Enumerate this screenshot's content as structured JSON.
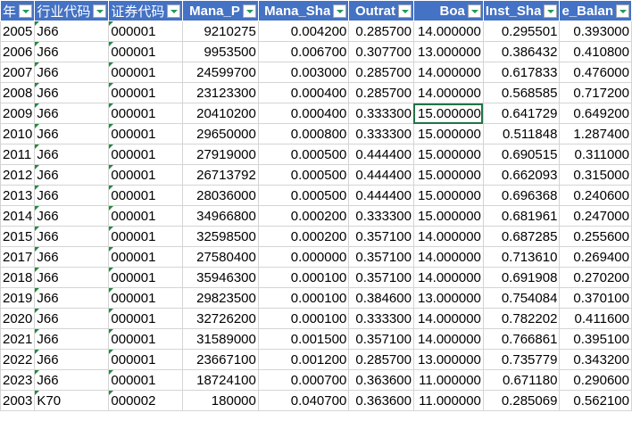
{
  "columns": [
    {
      "key": "year",
      "label": "年",
      "align": "txt"
    },
    {
      "key": "industry",
      "label": "行业代码",
      "align": "txt"
    },
    {
      "key": "code",
      "label": "证券代码",
      "align": "txt"
    },
    {
      "key": "mana_p",
      "label": "Mana_P",
      "align": "num"
    },
    {
      "key": "mana_sha",
      "label": "Mana_Sha",
      "align": "num"
    },
    {
      "key": "outrat",
      "label": "Outrat",
      "align": "num"
    },
    {
      "key": "boa",
      "label": "Boa",
      "align": "num"
    },
    {
      "key": "inst_sha",
      "label": "Inst_Sha",
      "align": "num"
    },
    {
      "key": "balance",
      "label": "e_Balan",
      "align": "num"
    }
  ],
  "rows": [
    [
      "2005",
      "J66",
      "000001",
      "9210275",
      "0.004200",
      "0.285700",
      "14.000000",
      "0.295501",
      "0.393000"
    ],
    [
      "2006",
      "J66",
      "000001",
      "9953500",
      "0.006700",
      "0.307700",
      "13.000000",
      "0.386432",
      "0.410800"
    ],
    [
      "2007",
      "J66",
      "000001",
      "24599700",
      "0.003000",
      "0.285700",
      "14.000000",
      "0.617833",
      "0.476000"
    ],
    [
      "2008",
      "J66",
      "000001",
      "23123300",
      "0.000400",
      "0.285700",
      "14.000000",
      "0.568585",
      "0.717200"
    ],
    [
      "2009",
      "J66",
      "000001",
      "20410200",
      "0.000400",
      "0.333300",
      "15.000000",
      "0.641729",
      "0.649200"
    ],
    [
      "2010",
      "J66",
      "000001",
      "29650000",
      "0.000800",
      "0.333300",
      "15.000000",
      "0.511848",
      "1.287400"
    ],
    [
      "2011",
      "J66",
      "000001",
      "27919000",
      "0.000500",
      "0.444400",
      "15.000000",
      "0.690515",
      "0.311000"
    ],
    [
      "2012",
      "J66",
      "000001",
      "26713792",
      "0.000500",
      "0.444400",
      "15.000000",
      "0.662093",
      "0.315000"
    ],
    [
      "2013",
      "J66",
      "000001",
      "28036000",
      "0.000500",
      "0.444400",
      "15.000000",
      "0.696368",
      "0.240600"
    ],
    [
      "2014",
      "J66",
      "000001",
      "34966800",
      "0.000200",
      "0.333300",
      "15.000000",
      "0.681961",
      "0.247000"
    ],
    [
      "2015",
      "J66",
      "000001",
      "32598500",
      "0.000200",
      "0.357100",
      "14.000000",
      "0.687285",
      "0.255600"
    ],
    [
      "2017",
      "J66",
      "000001",
      "27580400",
      "0.000000",
      "0.357100",
      "14.000000",
      "0.713610",
      "0.269400"
    ],
    [
      "2018",
      "J66",
      "000001",
      "35946300",
      "0.000100",
      "0.357100",
      "14.000000",
      "0.691908",
      "0.270200"
    ],
    [
      "2019",
      "J66",
      "000001",
      "29823500",
      "0.000100",
      "0.384600",
      "13.000000",
      "0.754084",
      "0.370100"
    ],
    [
      "2020",
      "J66",
      "000001",
      "32726200",
      "0.000100",
      "0.333300",
      "14.000000",
      "0.782202",
      "0.411600"
    ],
    [
      "2021",
      "J66",
      "000001",
      "31589000",
      "0.001500",
      "0.357100",
      "14.000000",
      "0.766861",
      "0.395100"
    ],
    [
      "2022",
      "J66",
      "000001",
      "23667100",
      "0.001200",
      "0.285700",
      "13.000000",
      "0.735779",
      "0.343200"
    ],
    [
      "2023",
      "J66",
      "000001",
      "18724100",
      "0.000700",
      "0.363600",
      "11.000000",
      "0.671180",
      "0.290600"
    ],
    [
      "2003",
      "K70",
      "000002",
      "180000",
      "0.040700",
      "0.363600",
      "11.000000",
      "0.285069",
      "0.562100"
    ]
  ],
  "selected_cell": {
    "row": 4,
    "col": 6
  },
  "colors": {
    "header_bg": "#4472c4",
    "header_text": "#ffffff",
    "grid": "#d4d4d4",
    "selection": "#217346",
    "flag": "#1e8c3a"
  }
}
